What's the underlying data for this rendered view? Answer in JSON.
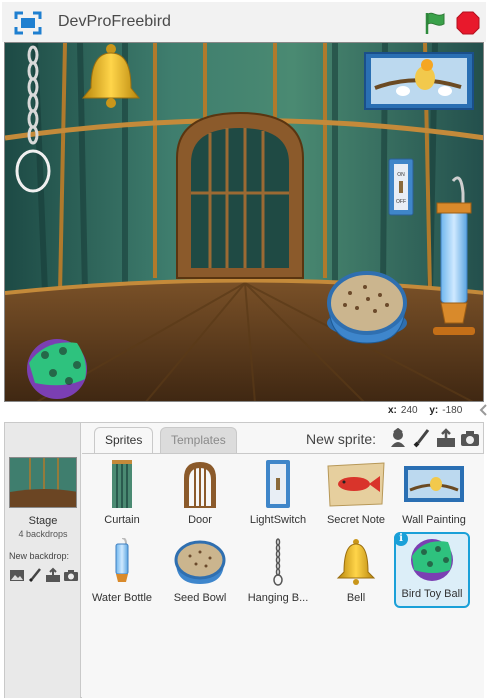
{
  "project": {
    "title": "DevProFreebird"
  },
  "controls": {
    "fullscreen_icon": "fullscreen-icon",
    "green_flag_icon": "green-flag-icon",
    "stop_icon": "stop-sign-icon"
  },
  "coords": {
    "x_label": "x:",
    "x_value": "240",
    "y_label": "y:",
    "y_value": "-180"
  },
  "stage_pane": {
    "label": "Stage",
    "backdrops": "4 backdrops",
    "new_backdrop_label": "New backdrop:",
    "tools": [
      "paint-icon",
      "brush-icon",
      "upload-icon",
      "camera-icon"
    ]
  },
  "tabs": [
    {
      "label": "Sprites",
      "active": true
    },
    {
      "label": "Templates",
      "active": false
    }
  ],
  "new_sprite": {
    "label": "New sprite:",
    "tools": [
      "character-icon",
      "brush-icon",
      "upload-icon",
      "camera-icon"
    ]
  },
  "sprites": [
    {
      "name": "Curtain"
    },
    {
      "name": "Door"
    },
    {
      "name": "LightSwitch"
    },
    {
      "name": "Secret Note"
    },
    {
      "name": "Wall Painting"
    },
    {
      "name": "Water Bottle"
    },
    {
      "name": "Seed Bowl"
    },
    {
      "name": "Hanging B..."
    },
    {
      "name": "Bell"
    },
    {
      "name": "Bird Toy Ball",
      "selected": true
    }
  ],
  "stage_scene": {
    "switch_on": "ON",
    "switch_off": "OFF"
  },
  "colors": {
    "accent": "#1aa0d8",
    "flag": "#2e8b3d",
    "stop": "#e8192c"
  }
}
